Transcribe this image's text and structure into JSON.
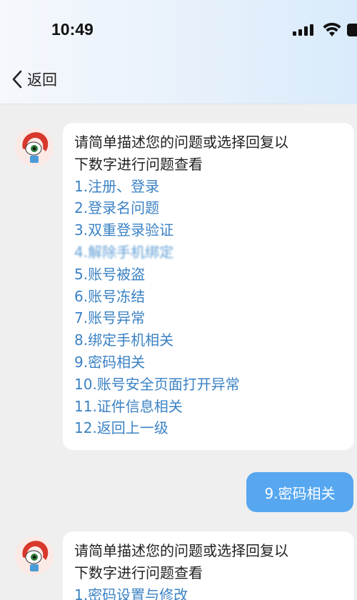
{
  "status_bar": {
    "time": "10:49",
    "icons": [
      "signal-icon",
      "wifi-icon",
      "battery-icon"
    ]
  },
  "nav": {
    "back_label": "返回"
  },
  "colors": {
    "header_gradient_start": "#f5f8fc",
    "header_gradient_end": "#d9ebfb",
    "option_link": "#3b82c4",
    "user_bubble": "#56a7f0",
    "background": "#efefef"
  },
  "messages": [
    {
      "sender": "bot",
      "prompt_line1": "请简单描述您的问题或选择回复以",
      "prompt_line2": "下数字进行问题查看",
      "options": [
        "1.注册、登录",
        "2.登录名问题",
        "3.双重登录验证",
        "4.解除手机绑定",
        "5.账号被盗",
        "6.账号冻结",
        "7.账号异常",
        "8.绑定手机相关",
        "9.密码相关",
        "10.账号安全页面打开异常",
        "11.证件信息相关",
        "12.返回上一级"
      ]
    },
    {
      "sender": "user",
      "text": "9.密码相关"
    },
    {
      "sender": "bot",
      "prompt_line1": "请简单描述您的问题或选择回复以",
      "prompt_line2": "下数字进行问题查看",
      "options": [
        "1.密码设置与修改"
      ]
    }
  ]
}
